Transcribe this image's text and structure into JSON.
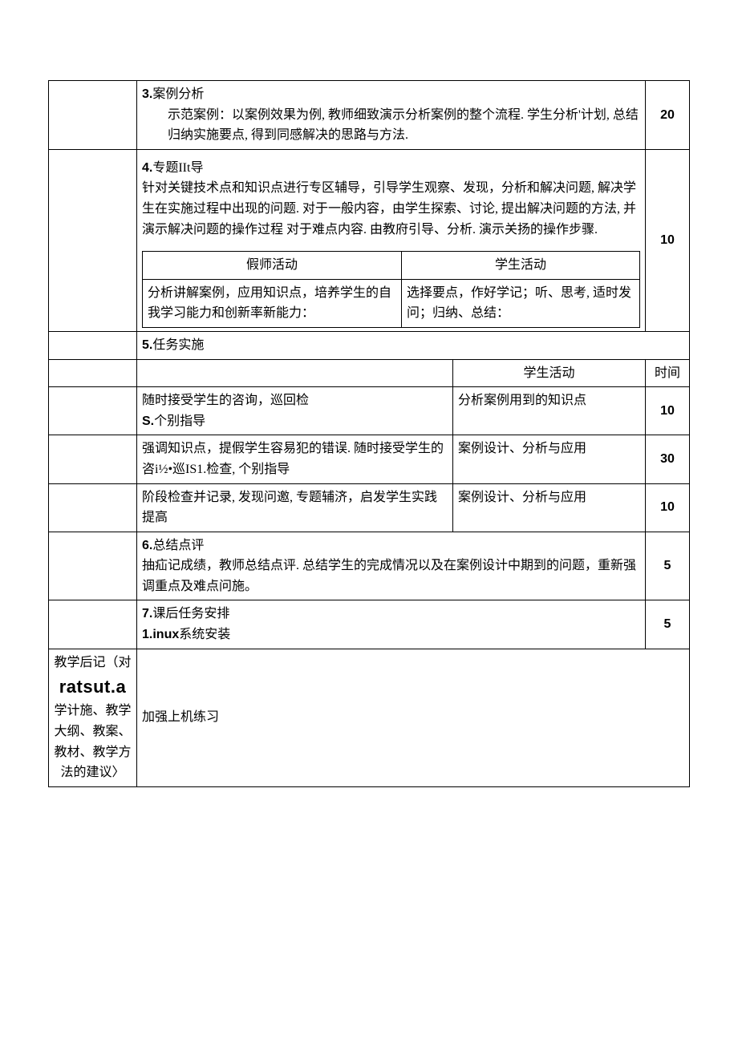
{
  "row1": {
    "num": "3.",
    "title": "案例分析",
    "body": "示范案例：以案例效果为例, 教师细致演示分析案例的整个流程. 学生分析'计划, 总结归纳实施要点, 得到同感解决的思路与方法.",
    "time": "20"
  },
  "row2": {
    "num": "4.",
    "title": "专题IIt导",
    "body": "针对关键技术点和知识点进行专区辅导，引导学生观察、发现，分析和解决问题, 解决学生在实施过程中出现的问题. 对于一般内容，由学生探索、讨论, 提出解决问题的方法, 并演示解决问题的操作过程 对于难点内容. 由教府引导、分析. 演示关扬的操作步骤.",
    "inner_head_left": "假师活动",
    "inner_head_right": "学生活动",
    "inner_left": "分析讲解案例，应用知识点，培养学生的自我学习能力和创新率新能力：",
    "inner_right": "选择要点，作好学记；听、思考, 适时发问；归纳、总结：",
    "time": "10"
  },
  "row3": {
    "num": "5.",
    "title": "任务实施"
  },
  "task_head": {
    "right": "学生活动",
    "time": "时间"
  },
  "task_rows": [
    {
      "left_a": "随时接受学生的咨询，巡回检",
      "left_b_bold": "S.",
      "left_b_rest": "个别指导",
      "right": "分析案例用到的知识点",
      "time": "10"
    },
    {
      "left": "强调知识点，提假学生容易犯的错误. 随时接受学生的咨i½•巡IS1.检查, 个别指导",
      "right": "案例设计、分析与应用",
      "time": "30"
    },
    {
      "left": "阶段检查并记录, 发现问邀, 专题辅济，启发学生实践提高",
      "right": "案例设计、分析与应用",
      "time": "10"
    }
  ],
  "row6": {
    "num": "6.",
    "title": "总结点评",
    "body": "抽疝记成绩，教师总结点评. 总结学生的完成情况以及在案例设计中期到的问题，重新强调重点及难点问施。",
    "time": "5"
  },
  "row7": {
    "num": "7.",
    "title": "课后任务安排",
    "sub_bold": "1.inux",
    "sub_rest": "系统安装",
    "time": "5"
  },
  "footer": {
    "left_1": "教学后记（对",
    "left_big": "ratsut.a",
    "left_2": "学计施、教学大纲、教案、教材、教学方法的建议〉",
    "right": "加强上机练习"
  }
}
